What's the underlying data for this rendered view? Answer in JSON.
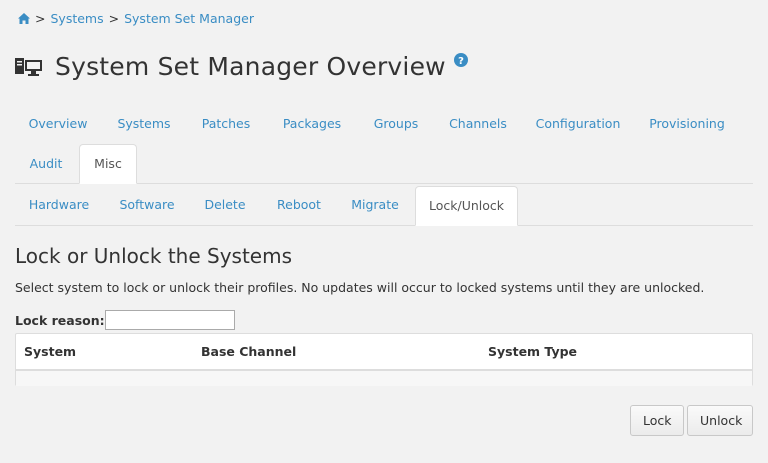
{
  "breadcrumb": {
    "home_icon": "home-icon",
    "separator": ">",
    "items": [
      "Systems",
      "System Set Manager"
    ]
  },
  "page": {
    "title": "System Set Manager Overview",
    "title_icon": "desktop-system-icon",
    "help_icon": "question-circle-icon"
  },
  "tabs_primary": [
    {
      "label": "Overview"
    },
    {
      "label": "Systems"
    },
    {
      "label": "Patches"
    },
    {
      "label": "Packages"
    },
    {
      "label": "Groups"
    },
    {
      "label": "Channels"
    },
    {
      "label": "Configuration"
    },
    {
      "label": "Provisioning"
    },
    {
      "label": "Audit"
    },
    {
      "label": "Misc",
      "active": true
    }
  ],
  "tabs_secondary": [
    {
      "label": "Hardware"
    },
    {
      "label": "Software"
    },
    {
      "label": "Delete"
    },
    {
      "label": "Reboot"
    },
    {
      "label": "Migrate"
    },
    {
      "label": "Lock/Unlock",
      "active": true
    }
  ],
  "section": {
    "title": "Lock or Unlock the Systems",
    "description": "Select system to lock or unlock their profiles. No updates will occur to locked systems until they are unlocked."
  },
  "lock_reason": {
    "label": "Lock reason:",
    "value": ""
  },
  "table": {
    "columns": [
      "System",
      "Base Channel",
      "System Type"
    ],
    "rows": []
  },
  "actions": {
    "lock_label": "Lock",
    "unlock_label": "Unlock"
  },
  "colors": {
    "link": "#3a8dc4",
    "background": "#f2f2f2",
    "border": "#dddddd"
  }
}
